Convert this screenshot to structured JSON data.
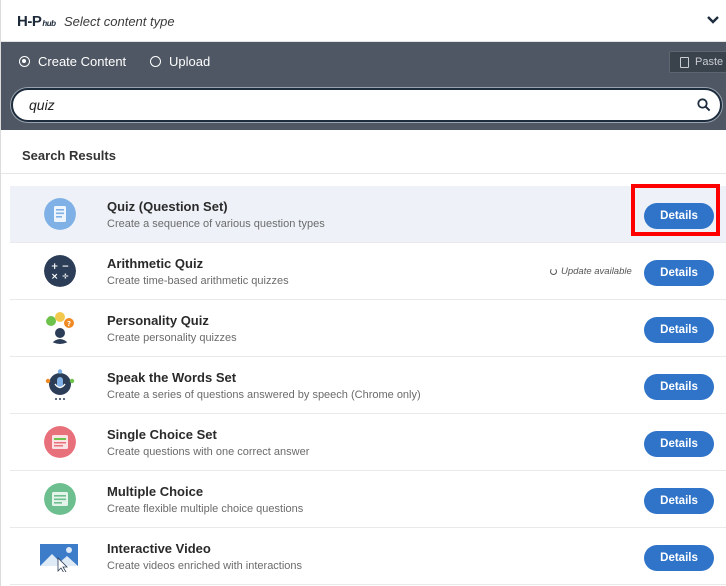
{
  "header": {
    "logo_text": "H-P",
    "logo_sub": "hub",
    "title": "Select content type"
  },
  "tabs": {
    "create_label": "Create Content",
    "upload_label": "Upload",
    "selected": "create"
  },
  "paste_label": "Paste",
  "search": {
    "value": "quiz",
    "placeholder": ""
  },
  "results_heading": "Search Results",
  "results": [
    {
      "title": "Quiz (Question Set)",
      "description": "Create a sequence of various question types",
      "details_label": "Details",
      "icon": "question-set-icon"
    },
    {
      "title": "Arithmetic Quiz",
      "description": "Create time-based arithmetic quizzes",
      "details_label": "Details",
      "update_text": "Update available",
      "icon": "arithmetic-icon"
    },
    {
      "title": "Personality Quiz",
      "description": "Create personality quizzes",
      "details_label": "Details",
      "icon": "personality-icon"
    },
    {
      "title": "Speak the Words Set",
      "description": "Create a series of questions answered by speech (Chrome only)",
      "details_label": "Details",
      "icon": "microphone-icon"
    },
    {
      "title": "Single Choice Set",
      "description": "Create questions with one correct answer",
      "details_label": "Details",
      "icon": "single-choice-icon"
    },
    {
      "title": "Multiple Choice",
      "description": "Create flexible multiple choice questions",
      "details_label": "Details",
      "icon": "multiple-choice-icon"
    },
    {
      "title": "Interactive Video",
      "description": "Create videos enriched with interactions",
      "details_label": "Details",
      "icon": "interactive-video-icon"
    }
  ],
  "colors": {
    "accent_button": "#2f74c8",
    "tab_bar": "#4e5763",
    "highlight_box": "#ff0000"
  }
}
